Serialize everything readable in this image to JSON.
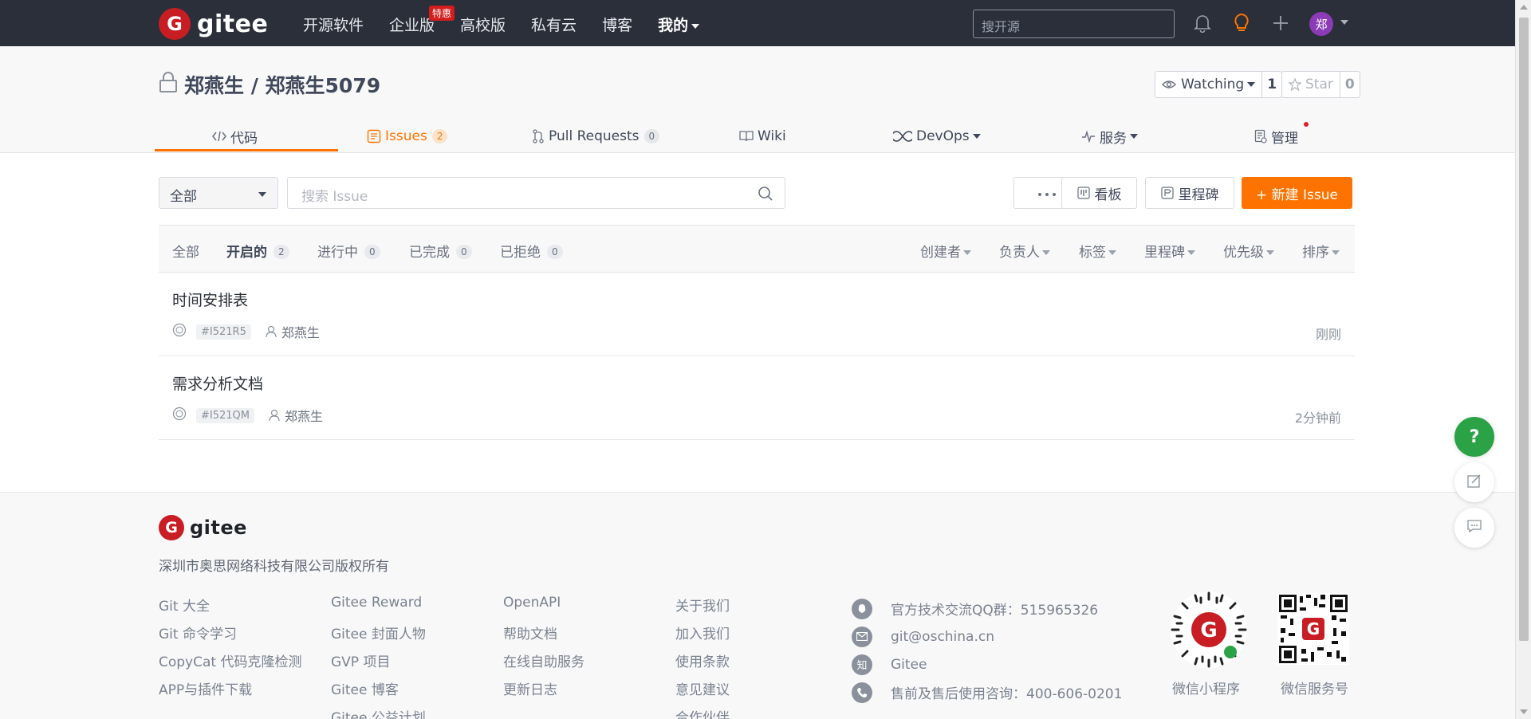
{
  "topnav": {
    "logo_text": "gitee",
    "items": [
      {
        "label": "开源软件"
      },
      {
        "label": "企业版",
        "badge": "特惠"
      },
      {
        "label": "高校版"
      },
      {
        "label": "私有云"
      },
      {
        "label": "博客"
      },
      {
        "label": "我的"
      }
    ],
    "search_placeholder": "搜开源",
    "avatar_text": "郑"
  },
  "repo": {
    "title": "郑燕生 / 郑燕生5079",
    "watch_label": "Watching",
    "watch_count": "1",
    "star_label": "Star",
    "star_count": "0"
  },
  "tabs": [
    {
      "label": "代码"
    },
    {
      "label": "Issues",
      "count": "2"
    },
    {
      "label": "Pull Requests",
      "count": "0"
    },
    {
      "label": "Wiki"
    },
    {
      "label": "DevOps"
    },
    {
      "label": "服务"
    },
    {
      "label": "管理"
    }
  ],
  "toolbar": {
    "filter_value": "全部",
    "search_placeholder": "搜索 Issue",
    "kanban_label": "看板",
    "milestone_label": "里程碑",
    "new_issue_label": "+ 新建 Issue"
  },
  "states": [
    {
      "label": "全部"
    },
    {
      "label": "开启的",
      "count": "2"
    },
    {
      "label": "进行中",
      "count": "0"
    },
    {
      "label": "已完成",
      "count": "0"
    },
    {
      "label": "已拒绝",
      "count": "0"
    }
  ],
  "sorters": [
    "创建者",
    "负责人",
    "标签",
    "里程碑",
    "优先级",
    "排序"
  ],
  "issues": [
    {
      "title": "时间安排表",
      "number": "#I521R5",
      "author": "郑燕生",
      "time": "刚刚"
    },
    {
      "title": "需求分析文档",
      "number": "#I521QM",
      "author": "郑燕生",
      "time": "2分钟前"
    }
  ],
  "footer": {
    "logo_text": "gitee",
    "company": "深圳市奥思网络科技有限公司版权所有",
    "col1": [
      "Git 大全",
      "Git 命令学习",
      "CopyCat 代码克隆检测",
      "APP与插件下载"
    ],
    "col2": [
      "Gitee Reward",
      "Gitee 封面人物",
      "GVP 项目",
      "Gitee 博客",
      "Gitee 公益计划"
    ],
    "col3": [
      "OpenAPI",
      "帮助文档",
      "在线自助服务",
      "更新日志"
    ],
    "col4": [
      "关于我们",
      "加入我们",
      "使用条款",
      "意见建议",
      "合作伙伴"
    ],
    "contacts": [
      {
        "icon": "qq-icon",
        "text": "官方技术交流QQ群：515965326"
      },
      {
        "icon": "mail-icon",
        "text": "git@oschina.cn"
      },
      {
        "icon": "zhihu-icon",
        "glyph": "知",
        "text": "Gitee"
      },
      {
        "icon": "phone-icon",
        "text": "售前及售后使用咨询：400-606-0201"
      }
    ],
    "qr1_label": "微信小程序",
    "qr2_label": "微信服务号"
  },
  "float": {
    "help": "?"
  },
  "colors": {
    "brand": "#fe7300",
    "nav_bg": "#2a2f3a",
    "logo_red": "#c71d23",
    "help_green": "#2ba245"
  }
}
